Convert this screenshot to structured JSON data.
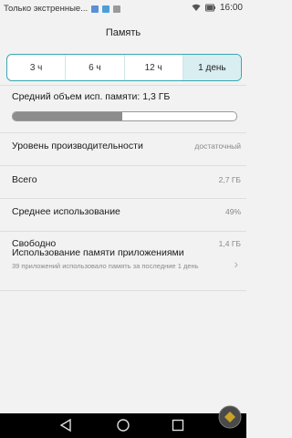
{
  "status_bar": {
    "notification_text": "Только экстренные...",
    "time": "16:00",
    "icons": [
      "notification-icon-blue",
      "notification-icon-blue-2",
      "notification-icon-grey",
      "wifi-icon",
      "battery-icon"
    ]
  },
  "app_bar": {
    "title": "Память"
  },
  "tabs": [
    {
      "label": "3 ч",
      "active": false
    },
    {
      "label": "6 ч",
      "active": false
    },
    {
      "label": "12 ч",
      "active": false
    },
    {
      "label": "1 день",
      "active": true
    }
  ],
  "memory": {
    "average_label": "Средний объем исп. памяти: 1,3 ГБ",
    "usage_fraction": 0.49
  },
  "rows": [
    {
      "label": "Уровень производительности",
      "value": "достаточный"
    },
    {
      "label": "Всего",
      "value": "2,7 ГБ"
    },
    {
      "label": "Среднее использование",
      "value": "49%"
    },
    {
      "label": "Свободно",
      "value": "1,4 ГБ"
    }
  ],
  "app_usage": {
    "title": "Использование памяти приложениями",
    "description": "39 приложений использовало память за последние 1 день"
  },
  "nav_bar": {
    "icons": [
      "back-icon",
      "home-icon",
      "recents-icon"
    ]
  },
  "colors": {
    "accent": "#3aa7b0",
    "tab_active_bg": "#d8eef0",
    "bar_fill": "#8c8c8c",
    "background": "#f2f2f2"
  }
}
